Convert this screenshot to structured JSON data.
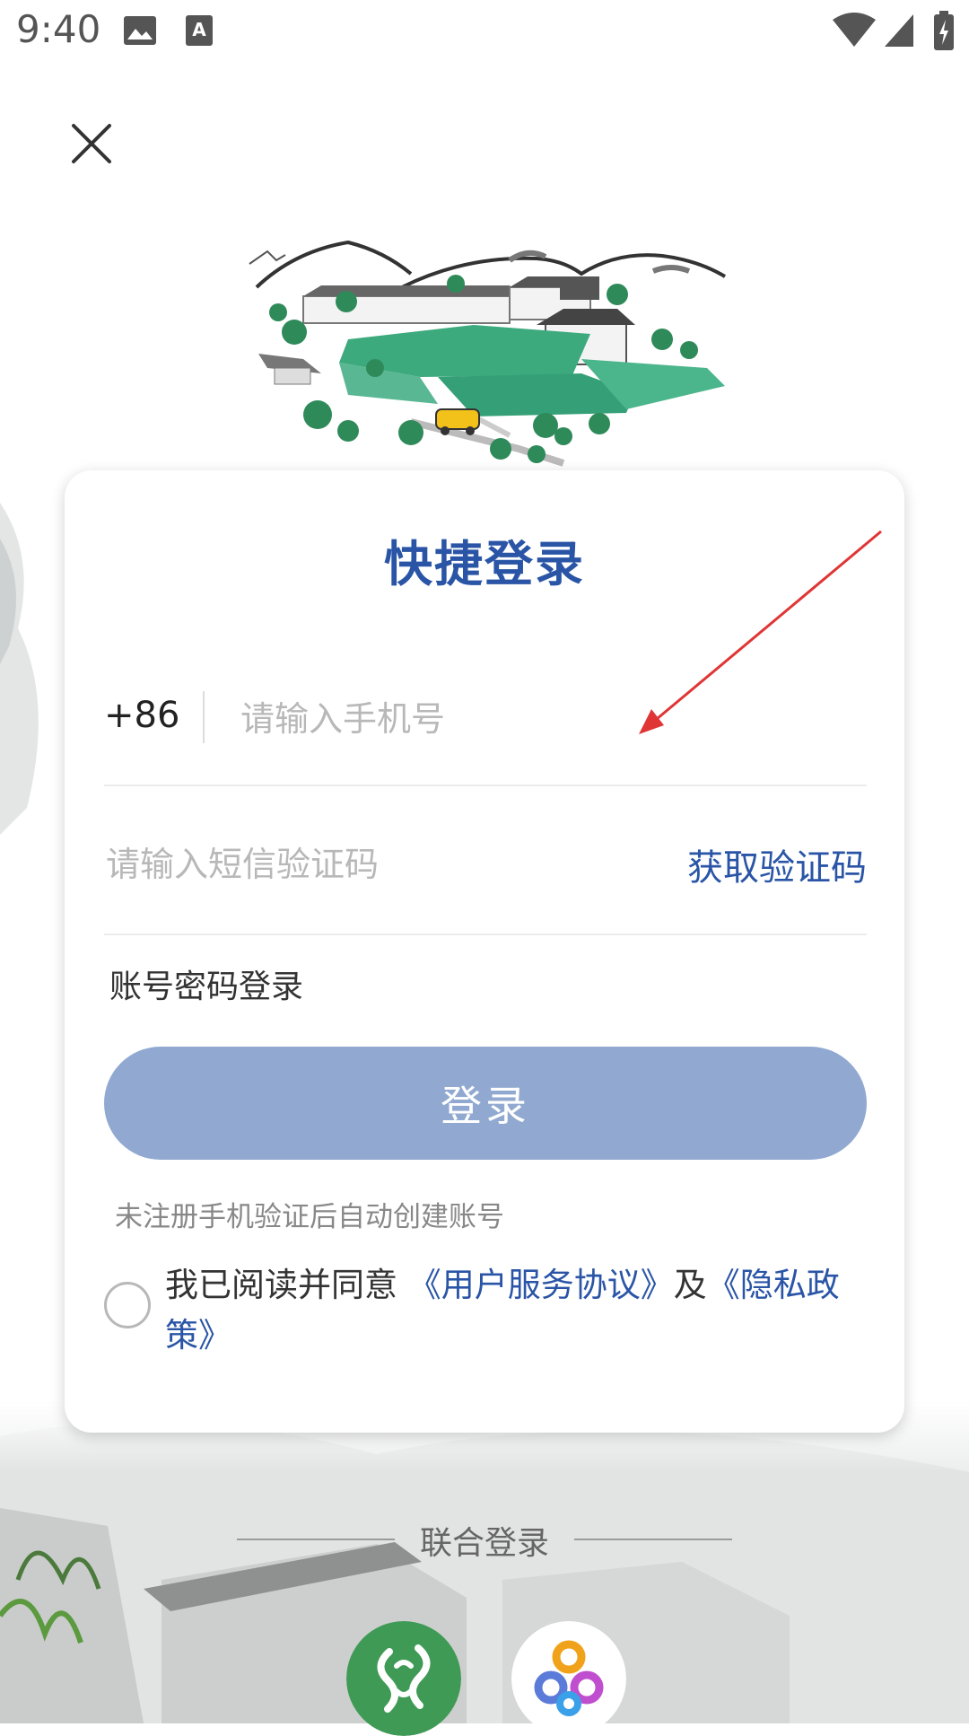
{
  "status_bar": {
    "time": "9:40"
  },
  "card": {
    "title": "快捷登录",
    "country_code": "+86",
    "phone_placeholder": "请输入手机号",
    "sms_placeholder": "请输入短信验证码",
    "get_code_label": "获取验证码",
    "password_login_label": "账号密码登录",
    "login_button_label": "登录",
    "hint": "未注册手机验证后自动创建账号",
    "agreement": {
      "prefix": "我已阅读并同意 ",
      "user_agreement": "《用户服务协议》",
      "and": "及",
      "privacy_policy": "《隐私政策》"
    }
  },
  "joint_login": {
    "label": "联合登录"
  },
  "colors": {
    "accent": "#2a55a6",
    "button": "#91a9d1",
    "social_green": "#3f9a55"
  },
  "icons": [
    "image-icon",
    "text-icon",
    "wifi-icon",
    "signal-icon",
    "battery-icon",
    "close-icon",
    "arrow-annotation-icon",
    "green-app-icon",
    "colorful-app-icon"
  ]
}
